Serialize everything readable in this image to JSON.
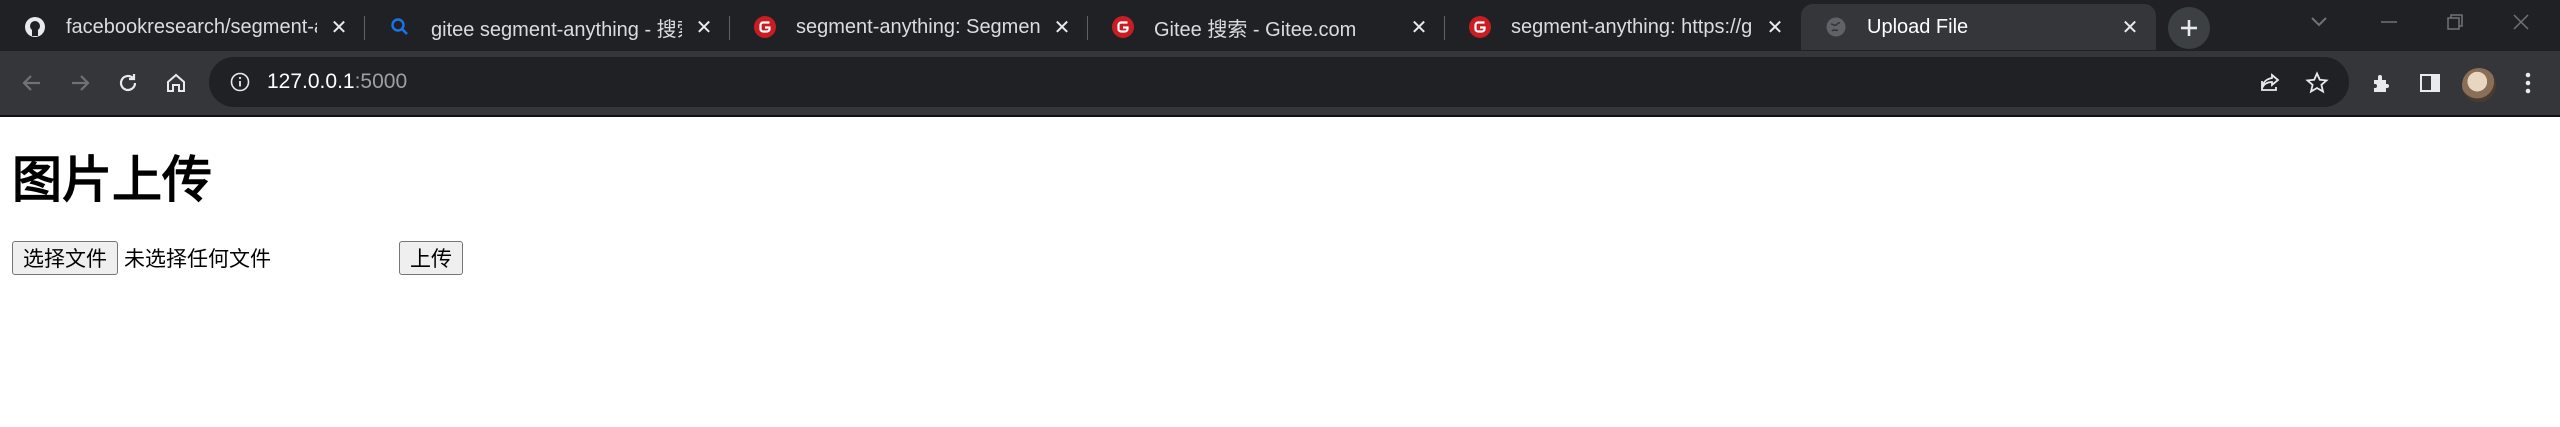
{
  "tabs": [
    {
      "title": "facebookresearch/segment-anything",
      "favicon": "github-icon"
    },
    {
      "title": "gitee segment-anything - 搜索",
      "favicon": "search-icon"
    },
    {
      "title": "segment-anything: Segment Anything",
      "favicon": "gitee-icon"
    },
    {
      "title": "Gitee 搜索 - Gitee.com",
      "favicon": "gitee-icon"
    },
    {
      "title": "segment-anything: https://github.com",
      "favicon": "gitee-icon"
    },
    {
      "title": "Upload File",
      "favicon": "globe-icon",
      "active": true
    }
  ],
  "address": {
    "host": "127.0.0.1",
    "port": ":5000"
  },
  "page": {
    "heading": "图片上传",
    "choose_file_label": "选择文件",
    "no_file_text": "未选择任何文件",
    "upload_label": "上传"
  },
  "colors": {
    "gitee_red": "#c71d23",
    "search_blue": "#1a73e8",
    "chrome_dark": "#202124",
    "toolbar": "#35363a"
  }
}
